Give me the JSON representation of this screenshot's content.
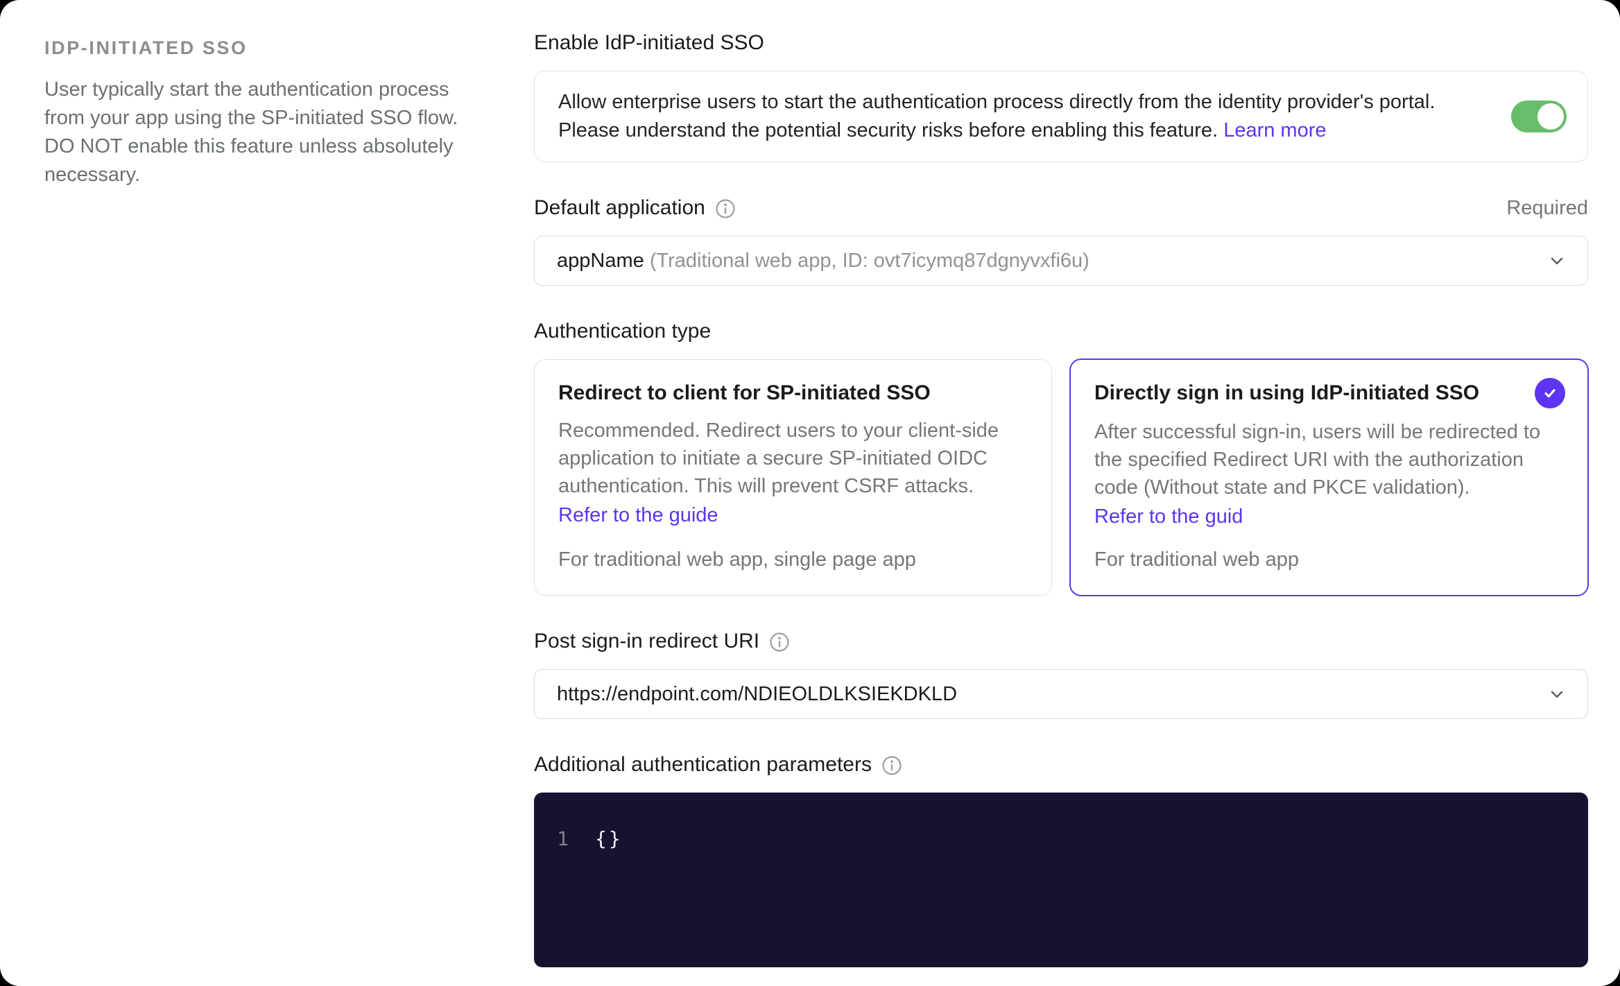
{
  "colors": {
    "accent": "#5d34f2",
    "toggle-on": "#67bd6a",
    "editor-bg": "#191130"
  },
  "sidebar": {
    "heading": "IDP-INITIATED SSO",
    "description": "User typically start the authentication process from your app using the SP-initiated SSO flow. DO NOT enable this feature unless absolutely necessary."
  },
  "enable": {
    "label": "Enable IdP-initiated SSO",
    "text_lines": [
      "Allow enterprise users to start the authentication process directly from the identity provider's portal.",
      "Please understand the potential security risks before enabling this feature."
    ],
    "learn_more_label": "Learn more",
    "toggle_state": "on"
  },
  "default_app": {
    "label": "Default application",
    "required_label": "Required",
    "value_name": "appName",
    "value_detail": "(Traditional web app, ID: ovt7icymq87dgnyvxfi6u)"
  },
  "auth_type": {
    "label": "Authentication type",
    "options": [
      {
        "title": "Redirect to client for SP-initiated SSO",
        "description": "Recommended. Redirect users to your client-side application to initiate a secure SP-initiated OIDC authentication. This will prevent CSRF attacks.",
        "link_label": "Refer to the guide",
        "footnote": "For traditional web app, single page app",
        "selected": false
      },
      {
        "title": "Directly sign in using IdP-initiated SSO",
        "description": "After successful sign-in, users will be redirected to the specified Redirect URI with the authorization code (Without state and PKCE validation).",
        "link_label": "Refer to the guid",
        "footnote": "For traditional web app",
        "selected": true
      }
    ]
  },
  "redirect_uri": {
    "label": "Post sign-in redirect URI",
    "value": "https://endpoint.com/NDIEOLDLKSIEKDKLD"
  },
  "additional_params": {
    "label": "Additional authentication parameters",
    "line_number": "1",
    "code": "{}"
  }
}
